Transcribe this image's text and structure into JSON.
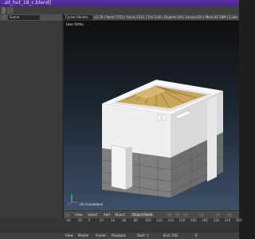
{
  "window": {
    "title": "..sit_hut_18_c.blend]"
  },
  "header": {
    "editor_label": "Scene",
    "render_label": "Cycles Render",
    "stats": "v2.78 | Verts:1552 | Faces:1341 | Tris:3.4k | Objects:1/8 | Lamps:0/0 | Mem:41.58M | Cubes1 | Foundation"
  },
  "viewport": {
    "view_label": "User Ortho",
    "object_label": "(0) Foundation"
  },
  "view_header": {
    "view": "View",
    "select": "Select",
    "add": "Add",
    "object": "Object",
    "mode": "Object Mode"
  },
  "timeline": {
    "ticks": [
      "-40",
      "-20",
      "0",
      "20",
      "40",
      "60",
      "80",
      "100",
      "120",
      "140",
      "160",
      "180",
      "200",
      "220",
      "240",
      "260"
    ]
  },
  "bottombar": {
    "view": "View",
    "marker": "Marker",
    "frame": "Frame",
    "playback": "Playback",
    "start": "Start: 1",
    "end": "End: 250",
    "current": "0"
  },
  "colors": {
    "title_bg": "#5a2fa5",
    "viewport_top": "#101010",
    "viewport_bottom": "#3d5068",
    "walls": "#f2f2f2",
    "stone": "#7a7a7a",
    "thatch": "#c8a55a"
  }
}
